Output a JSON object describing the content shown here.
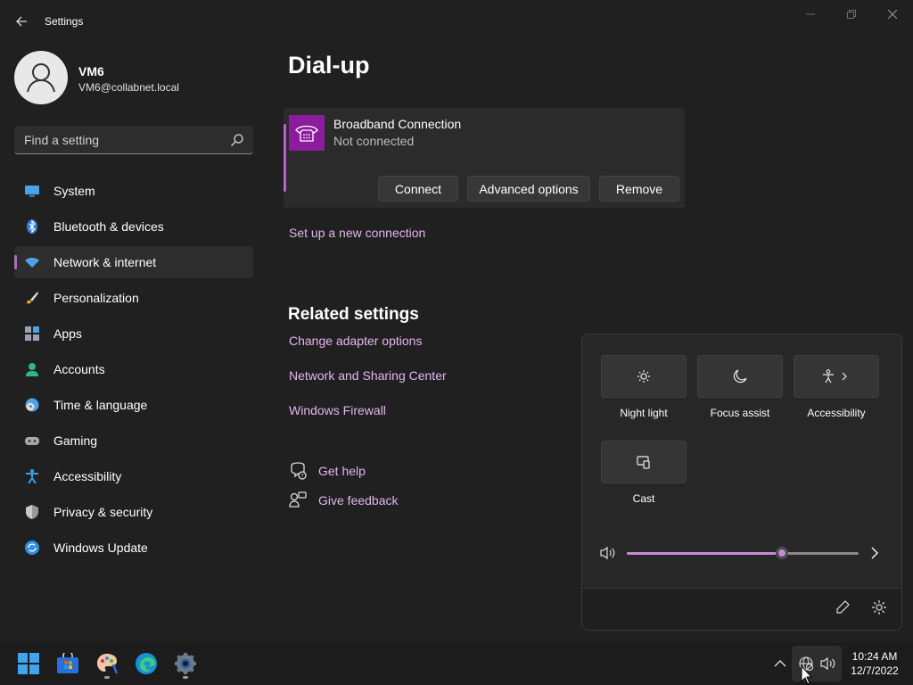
{
  "window": {
    "title": "Settings",
    "controls": [
      "minimize",
      "maximize",
      "close"
    ]
  },
  "profile": {
    "name": "VM6",
    "email": "VM6@collabnet.local"
  },
  "search": {
    "placeholder": "Find a setting"
  },
  "sidebar": {
    "items": [
      {
        "label": "System",
        "icon": "monitor-icon"
      },
      {
        "label": "Bluetooth & devices",
        "icon": "bluetooth-icon"
      },
      {
        "label": "Network & internet",
        "icon": "wifi-icon",
        "active": true
      },
      {
        "label": "Personalization",
        "icon": "brush-icon"
      },
      {
        "label": "Apps",
        "icon": "apps-icon"
      },
      {
        "label": "Accounts",
        "icon": "person-icon"
      },
      {
        "label": "Time & language",
        "icon": "clock-globe-icon"
      },
      {
        "label": "Gaming",
        "icon": "gamepad-icon"
      },
      {
        "label": "Accessibility",
        "icon": "accessibility-icon"
      },
      {
        "label": "Privacy & security",
        "icon": "shield-icon"
      },
      {
        "label": "Windows Update",
        "icon": "update-icon"
      }
    ]
  },
  "main": {
    "title": "Dial-up",
    "connection": {
      "name": "Broadband Connection",
      "status": "Not connected",
      "buttons": {
        "connect": "Connect",
        "advanced": "Advanced options",
        "remove": "Remove"
      }
    },
    "setup_link": "Set up a new connection",
    "related": {
      "heading": "Related settings",
      "links": [
        "Change adapter options",
        "Network and Sharing Center",
        "Windows Firewall"
      ]
    },
    "help": {
      "get_help": "Get help",
      "give_feedback": "Give feedback"
    }
  },
  "quick_settings": {
    "tiles": {
      "night_light": "Night light",
      "focus_assist": "Focus assist",
      "accessibility": "Accessibility",
      "cast": "Cast"
    },
    "volume_percent": 67
  },
  "taskbar": {
    "apps": [
      "start-icon",
      "store-icon",
      "paint-icon",
      "edge-icon",
      "settings-icon"
    ],
    "clock": {
      "time": "10:24 AM",
      "date": "12/7/2022"
    }
  },
  "colors": {
    "accent": "#b565c9",
    "link": "#e3b6ee",
    "dialup_tile": "#8b1c9e",
    "background": "#202020"
  }
}
